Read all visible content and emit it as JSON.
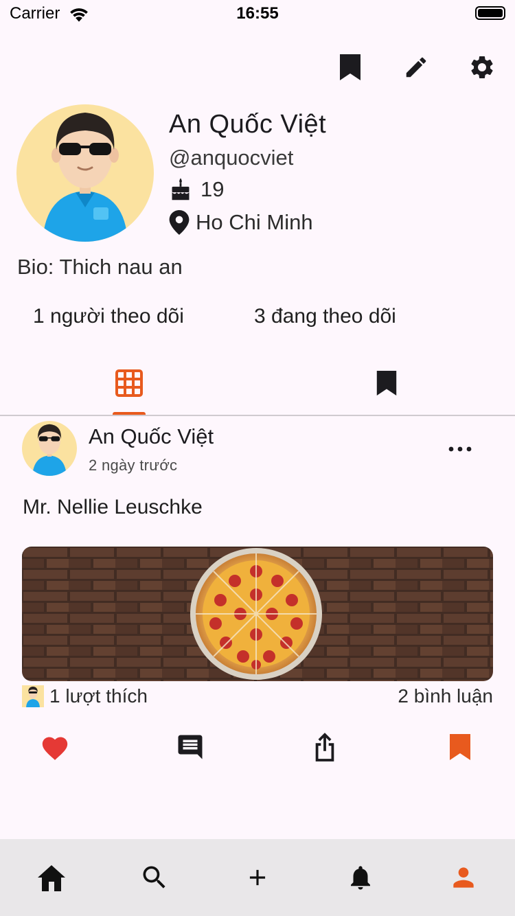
{
  "status_bar": {
    "carrier": "Carrier",
    "time": "16:55"
  },
  "toolbar": {
    "icons": [
      "bookmark-icon",
      "edit-icon",
      "settings-icon"
    ]
  },
  "profile": {
    "name": "An Quốc Việt",
    "handle": "@anquocviet",
    "age": "19",
    "location": "Ho Chi Minh",
    "bio": "Bio: Thich nau an",
    "followers": "1 người theo dõi",
    "following": "3 đang theo dõi"
  },
  "tabs": [
    {
      "icon": "grid-icon",
      "selected": true
    },
    {
      "icon": "bookmark-icon",
      "selected": false
    }
  ],
  "post": {
    "author": "An Quốc Việt",
    "time": "2 ngày trước",
    "text": "Mr. Nellie Leuschke",
    "likes": "1 lượt thích",
    "comments": "2 bình luận",
    "liked": true,
    "saved": true
  },
  "bottom_nav": {
    "items": [
      "home-icon",
      "search-icon",
      "add-icon",
      "notifications-icon",
      "profile-icon"
    ],
    "active": "profile-icon"
  },
  "colors": {
    "accent": "#e85a1e",
    "like": "#e53935",
    "background": "#fef7fd",
    "nav_background": "#e9e7e9"
  }
}
